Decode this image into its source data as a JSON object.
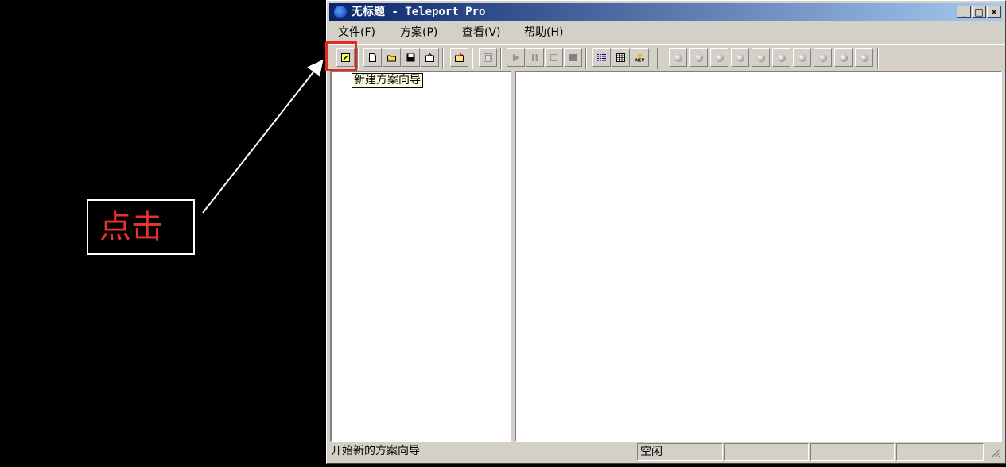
{
  "annotation": {
    "label": "点击"
  },
  "window": {
    "title": "无标题 - Teleport Pro",
    "controls": {
      "minimize": "_",
      "maximize": "□",
      "close": "×"
    }
  },
  "menu": [
    {
      "label": "文件",
      "key": "F"
    },
    {
      "label": "方案",
      "key": "P"
    },
    {
      "label": "查看",
      "key": "V"
    },
    {
      "label": "帮助",
      "key": "H"
    }
  ],
  "toolbar": {
    "tooltip": "新建方案向导",
    "buttons": [
      "new-project-wizard-icon",
      "new-file-icon",
      "open-folder-icon",
      "save-icon",
      "properties-icon",
      "new-address-icon",
      "browse-icon",
      "start-icon",
      "pause-icon",
      "stop-step-icon",
      "stop-icon",
      "list-view-icon",
      "grid-view-icon",
      "new-icon"
    ],
    "slot_count": 10
  },
  "status": {
    "message": "开始新的方案向导",
    "state": "空闲"
  },
  "colors": {
    "accent_red": "#e32a22",
    "title_start": "#0a246a",
    "title_end": "#a6caf0"
  }
}
